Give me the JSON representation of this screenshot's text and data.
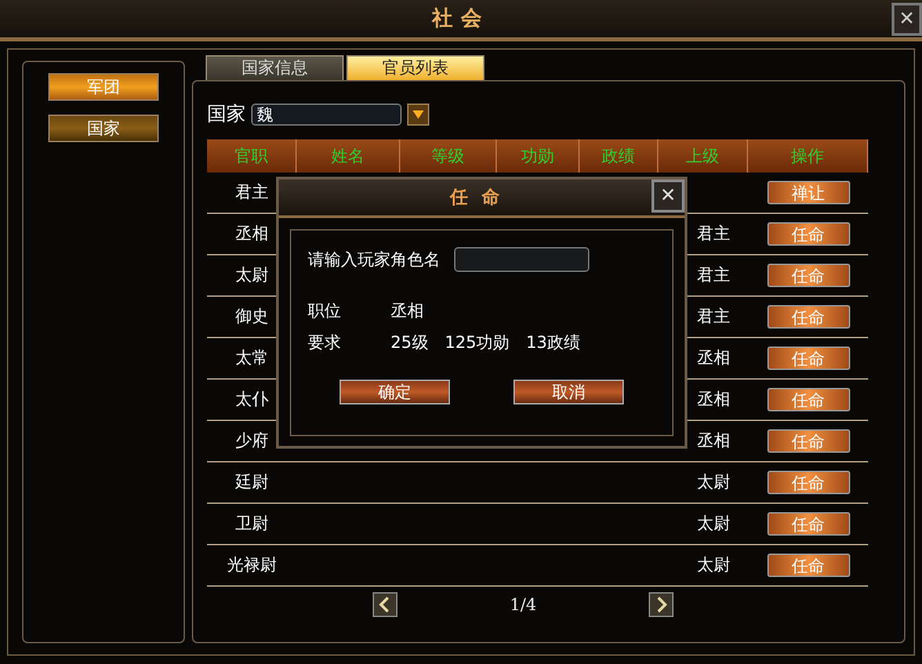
{
  "window": {
    "title": "社会",
    "close": "✕"
  },
  "sidebar": {
    "items": [
      {
        "label": "军团",
        "selected": true
      },
      {
        "label": "国家",
        "selected": false
      }
    ]
  },
  "tabs": [
    {
      "label": "国家信息",
      "selected": false
    },
    {
      "label": "官员列表",
      "selected": true
    }
  ],
  "country": {
    "label": "国家",
    "value": "魏"
  },
  "table": {
    "columns": [
      "官职",
      "姓名",
      "等级",
      "功勋",
      "政绩",
      "上级",
      "操作"
    ],
    "rows": [
      {
        "title": "君主",
        "action": "禅让"
      },
      {
        "title": "丞相",
        "superior": "君主",
        "action": "任命"
      },
      {
        "title": "太尉",
        "superior": "君主",
        "action": "任命"
      },
      {
        "title": "御史",
        "superior": "君主",
        "action": "任命"
      },
      {
        "title": "太常",
        "superior": "丞相",
        "action": "任命"
      },
      {
        "title": "太仆",
        "superior": "丞相",
        "action": "任命"
      },
      {
        "title": "少府",
        "superior": "丞相",
        "action": "任命"
      },
      {
        "title": "廷尉",
        "superior": "太尉",
        "action": "任命"
      },
      {
        "title": "卫尉",
        "superior": "太尉",
        "action": "任命"
      },
      {
        "title": "光禄尉",
        "superior": "太尉",
        "action": "任命"
      }
    ]
  },
  "pagination": {
    "page": "1/4"
  },
  "dialog": {
    "title": "任命",
    "close": "✕",
    "input_label": "请输入玩家角色名",
    "fields": [
      {
        "label": "职位",
        "value": "丞相"
      },
      {
        "label": "要求",
        "value": "25级　125功勋　13政绩"
      }
    ],
    "buttons": [
      "确定",
      "取消"
    ]
  }
}
